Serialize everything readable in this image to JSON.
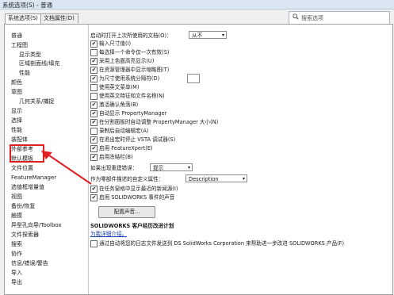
{
  "window": {
    "title": "系统选项(S) - 普通"
  },
  "tabs": [
    "系统选项(S)",
    "文档属性(D)"
  ],
  "search": {
    "placeholder": "搜索选项"
  },
  "tree": [
    "普通",
    "工程图",
    "显示类型",
    "区域剖面线/填充",
    "性能",
    "颜色",
    "草图",
    "几何关系/捕捉",
    "显示",
    "选择",
    "性能",
    "装配体",
    "外部参考",
    "默认模板",
    "文件位置",
    "FeatureManager",
    "选值框增量值",
    "视图",
    "备份/恢复",
    "触摸",
    "异型孔向导/Toolbox",
    "文件探索器",
    "搜索",
    "协作",
    "信息/错误/警告",
    "导入",
    "导出"
  ],
  "options": {
    "open_last_docs": {
      "label": "启动时打开上次所使用的文档(O)：",
      "value": "从不"
    },
    "checks": [
      {
        "label": "输入尺寸值(I)",
        "checked": true
      },
      {
        "label": "每选择一个命令仅一次有效(S)",
        "checked": false
      },
      {
        "label": "采用上色面高亮显示(U)",
        "checked": true
      },
      {
        "label": "在资源管理器中显示缩略图(T)",
        "checked": true
      },
      {
        "label": "为尺寸使用系统分隔符(D)",
        "checked": true
      },
      {
        "label": "使用英文菜单(M)",
        "checked": false
      },
      {
        "label": "使用英文特征和文件名称(N)",
        "checked": false
      },
      {
        "label": "激活确认角落(B)",
        "checked": true
      },
      {
        "label": "自动显示 PropertyManager",
        "checked": true
      },
      {
        "label": "在分割面板时自动调整 PropertyManager 大小(N)",
        "checked": true
      },
      {
        "label": "录制后自动编辑宏(A)",
        "checked": false
      },
      {
        "label": "在退出宏时停止 VSTA 调试器(S)",
        "checked": true
      },
      {
        "label": "启用 FeatureXpert(E)",
        "checked": true
      },
      {
        "label": "启用冻结栏(B)",
        "checked": true
      }
    ],
    "rebuild_error": {
      "label": "如果出现重建错误：",
      "value": "提示"
    },
    "custom_property": {
      "label": "作为零部件描述的自定义属性：",
      "value": "Description"
    },
    "recent_docs": {
      "label": "在任务窗格中显示最近的新闻源(I)",
      "checked": true
    },
    "sound": {
      "label": "启用 SOLIDWORKS 事件的声音",
      "checked": true
    },
    "sound_button": "配置声音...",
    "ceip": {
      "title": "SOLIDWORKS 客户经历改进计划",
      "link": "为我详细介绍。",
      "label": "通过自动将您的日志文件发送到 DS SolidWorks Corporation 来帮助进一步改进 SOLIDWORKS 产品(F)",
      "checked": false
    }
  }
}
